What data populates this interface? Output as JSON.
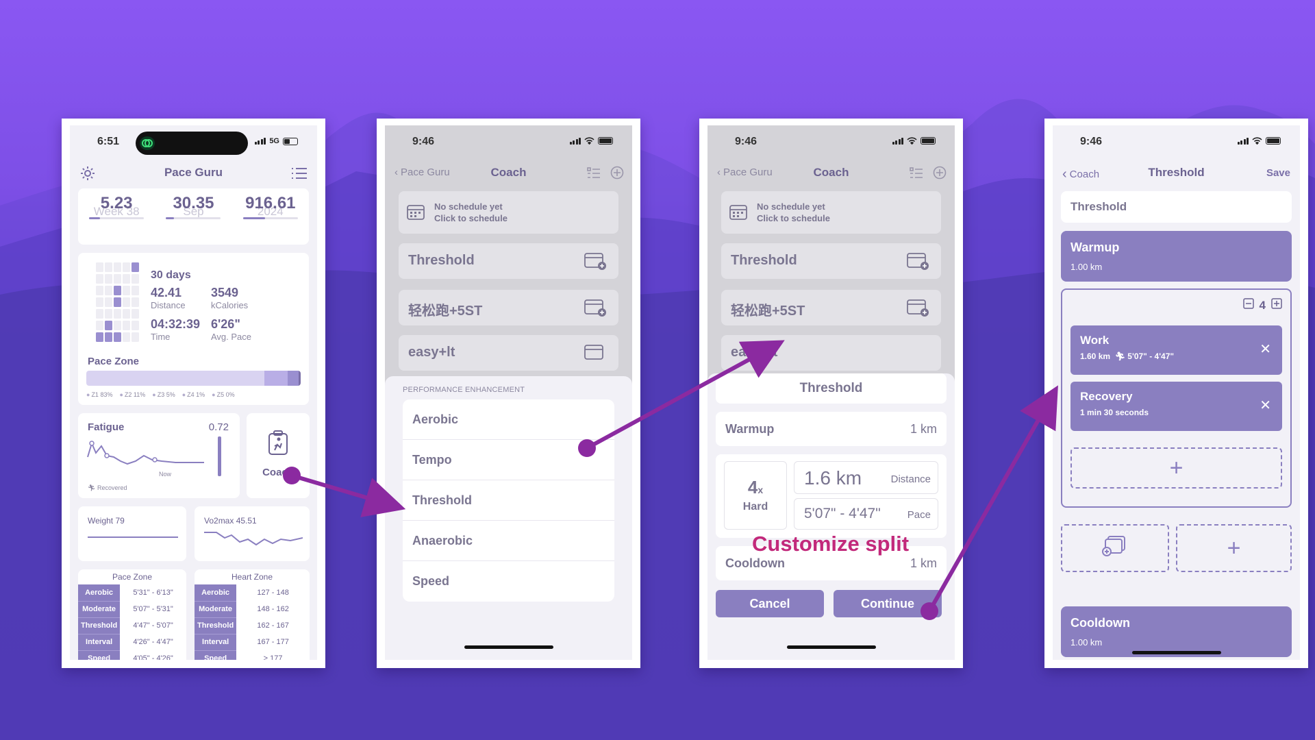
{
  "screen1": {
    "time": "6:51",
    "network": "5G",
    "title": "Pace Guru",
    "stats": [
      {
        "value": "5.23",
        "sub": "Week 38",
        "progress": 0.2
      },
      {
        "value": "30.35",
        "sub": "Sep",
        "progress": 0.15
      },
      {
        "value": "916.61",
        "sub": "2024",
        "progress": 0.4
      }
    ],
    "days_label": "30 days",
    "distance_value": "42.41",
    "distance_label": "Distance",
    "kcal_value": "3549",
    "kcal_label": "kCalories",
    "time_value": "04:32:39",
    "time_label": "Time",
    "pace_value": "6'26\"",
    "pace_label": "Avg. Pace",
    "pace_zone_title": "Pace Zone",
    "pace_zone_legend": [
      "Z1 83%",
      "Z2 11%",
      "Z3 5%",
      "Z4 1%",
      "Z5 0%"
    ],
    "pace_zone_fractions": [
      0.83,
      0.11,
      0.05,
      0.01,
      0.0
    ],
    "fatigue_title": "Fatigue",
    "fatigue_value": "0.72",
    "fatigue_now": "Now",
    "fatigue_recovered": "Recovered",
    "coach_label": "Coach",
    "weight_label": "Weight 79",
    "vo2_label": "Vo2max 45.51",
    "pace_table_title": "Pace Zone",
    "heart_table_title": "Heart Zone",
    "pace_table": [
      {
        "zone": "Aerobic",
        "range": "5'31\" - 6'13\""
      },
      {
        "zone": "Moderate",
        "range": "5'07\" - 5'31\""
      },
      {
        "zone": "Threshold",
        "range": "4'47\" - 5'07\""
      },
      {
        "zone": "Interval",
        "range": "4'26\" - 4'47\""
      },
      {
        "zone": "Speed",
        "range": "4'05\" - 4'26\""
      }
    ],
    "heart_table": [
      {
        "zone": "Aerobic",
        "range": "127 - 148"
      },
      {
        "zone": "Moderate",
        "range": "148 - 162"
      },
      {
        "zone": "Threshold",
        "range": "162 - 167"
      },
      {
        "zone": "Interval",
        "range": "167 - 177"
      },
      {
        "zone": "Speed",
        "range": "> 177"
      }
    ]
  },
  "coach_screen": {
    "time": "9:46",
    "back_label": "Pace Guru",
    "title": "Coach",
    "schedule_line1": "No schedule yet",
    "schedule_line2": "Click to schedule",
    "plans": [
      "Threshold",
      "轻松跑+5ST",
      "easy+lt"
    ]
  },
  "screen2": {
    "sheet_header": "PERFORMANCE ENHANCEMENT",
    "options": [
      "Aerobic",
      "Tempo",
      "Threshold",
      "Anaerobic",
      "Speed"
    ]
  },
  "screen3": {
    "sheet_title": "Threshold",
    "warmup_label": "Warmup",
    "warmup_value": "1 km",
    "repeat_count": "4",
    "repeat_x": "x",
    "intensity": "Hard",
    "distance_value": "1.6 km",
    "distance_label": "Distance",
    "pace_value": "5'07\" - 4'47\"",
    "pace_label": "Pace",
    "cooldown_label": "Cooldown",
    "cooldown_value": "1 km",
    "cancel_label": "Cancel",
    "continue_label": "Continue",
    "annotation": "Customize split"
  },
  "screen4": {
    "time": "9:46",
    "back_label": "Coach",
    "title": "Threshold",
    "save_label": "Save",
    "name_field": "Threshold",
    "warmup_title": "Warmup",
    "warmup_value": "1.00 km",
    "repeat_count": "4",
    "work_title": "Work",
    "work_distance": "1.60 km",
    "work_pace": "5'07\" - 4'47\"",
    "recovery_title": "Recovery",
    "recovery_value": "1 min 30 seconds",
    "cooldown_title": "Cooldown",
    "cooldown_value": "1.00 km"
  },
  "colors": {
    "accent": "#8a7fc0",
    "arrow": "#8b2aa0",
    "annotation": "#c2297b",
    "background": "#7d4fe6"
  }
}
